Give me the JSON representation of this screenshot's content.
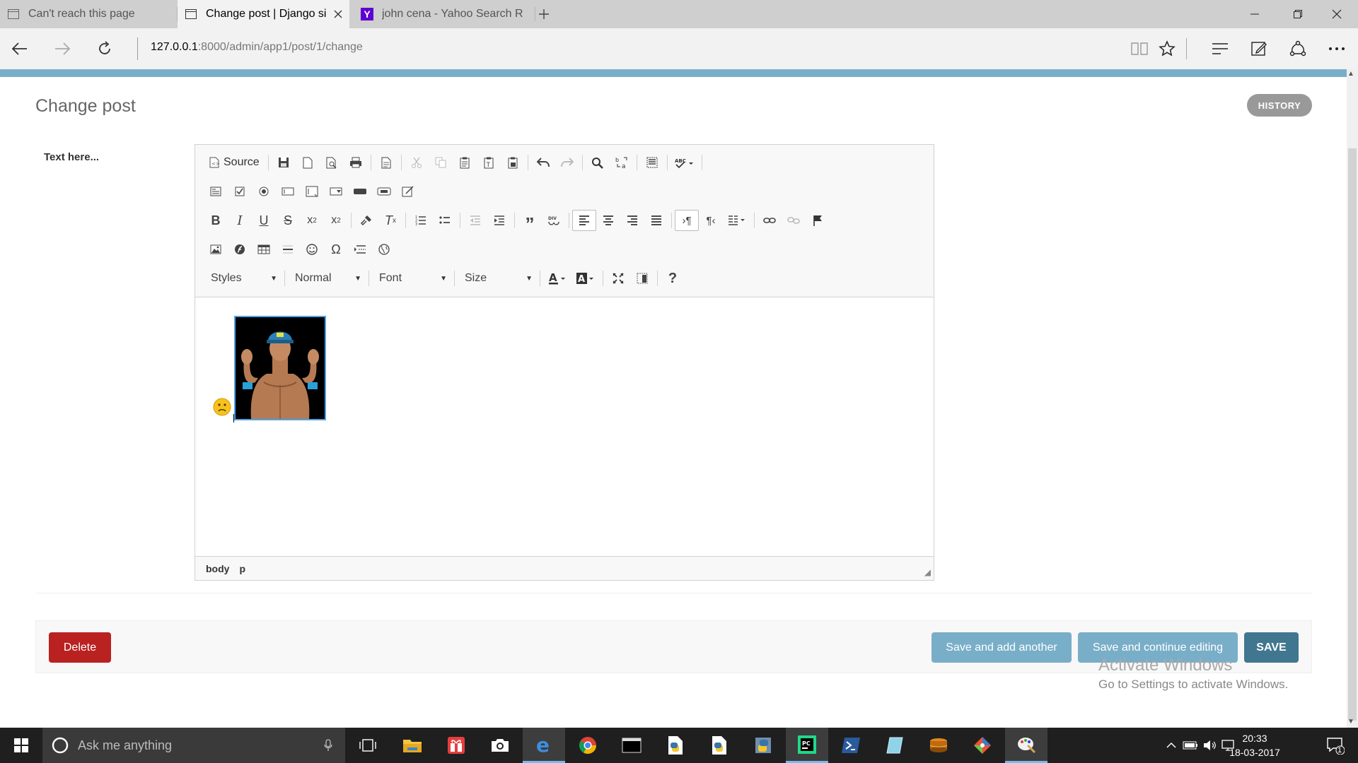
{
  "browser": {
    "tabs": [
      {
        "label": "Can't reach this page",
        "icon": "page-icon"
      },
      {
        "label": "Change post | Django si",
        "icon": "page-icon"
      },
      {
        "label": "john cena - Yahoo Search Re",
        "icon": "yahoo-icon"
      }
    ],
    "address": {
      "host": "127.0.0.1",
      "rest": ":8000/admin/app1/post/1/change"
    }
  },
  "page": {
    "title": "Change post",
    "history_label": "HISTORY",
    "field_label": "Text here..."
  },
  "editor": {
    "source_label": "Source",
    "styles_label": "Styles",
    "format_label": "Normal",
    "font_label": "Font",
    "size_label": "Size",
    "path": [
      "body",
      "p"
    ]
  },
  "actions": {
    "delete_label": "Delete",
    "save_add_label": "Save and add another",
    "save_continue_label": "Save and continue editing",
    "save_label": "SAVE"
  },
  "watermark": {
    "title": "Activate Windows",
    "subtitle": "Go to Settings to activate Windows."
  },
  "taskbar": {
    "search_placeholder": "Ask me anything",
    "time": "20:33",
    "date": "18-03-2017",
    "notification_count": "1"
  },
  "colors": {
    "admin_blue": "#79aec8",
    "save_blue": "#417690",
    "delete_red": "#ba2121"
  }
}
